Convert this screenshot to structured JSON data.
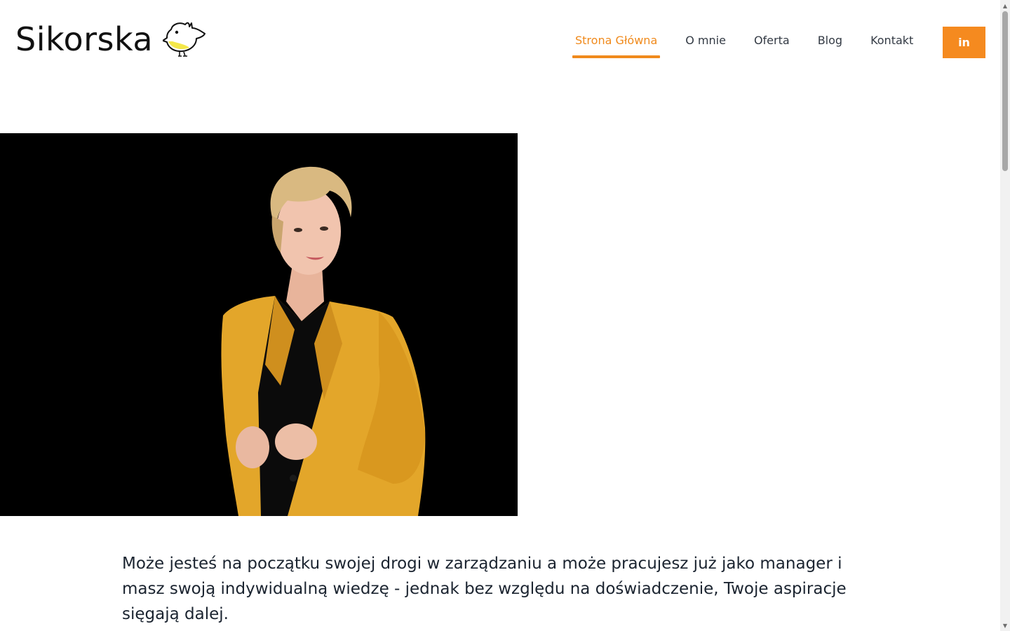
{
  "brand": {
    "name": "Sikorska",
    "logo_icon": "bird-icon"
  },
  "nav": {
    "items": [
      {
        "label": "Strona Główna",
        "active": true
      },
      {
        "label": "O mnie",
        "active": false
      },
      {
        "label": "Oferta",
        "active": false
      },
      {
        "label": "Blog",
        "active": false
      },
      {
        "label": "Kontakt",
        "active": false
      }
    ]
  },
  "social": {
    "label": "in",
    "icon": "linkedin-icon"
  },
  "hero": {
    "image": "portrait-photo"
  },
  "intro": {
    "text": "Może jesteś na początku swojej drogi w zarządzaniu a może pracujesz już jako manager i masz swoją indywidualną wiedzę - jednak bez względu na doświadczenie, Twoje aspiracje sięgają dalej."
  },
  "colors": {
    "accent": "#f58a1f",
    "text": "#1b2430",
    "hero_bg": "#000000",
    "jacket": "#e3a62a"
  }
}
